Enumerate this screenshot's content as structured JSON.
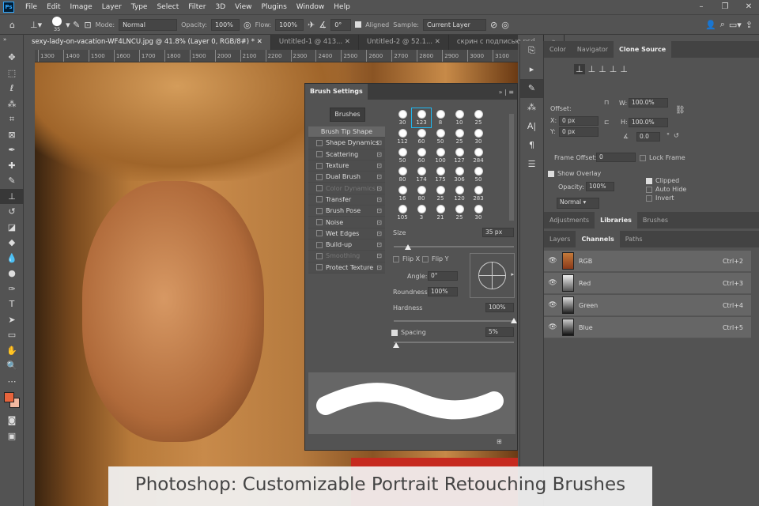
{
  "app": {
    "logo": "Ps"
  },
  "menu": [
    "File",
    "Edit",
    "Image",
    "Layer",
    "Type",
    "Select",
    "Filter",
    "3D",
    "View",
    "Plugins",
    "Window",
    "Help"
  ],
  "options": {
    "brush_size": "35",
    "mode_label": "Mode:",
    "mode": "Normal",
    "opacity_label": "Opacity:",
    "opacity": "100%",
    "flow_label": "Flow:",
    "flow": "100%",
    "angle": "0°",
    "aligned_label": "Aligned",
    "sample_label": "Sample:",
    "sample": "Current Layer"
  },
  "tabs": [
    "sexy-lady-on-vacation-WF4LNCU.jpg @ 41.8% (Layer 0, RGB/8#) *",
    "Untitled-1 @ 413...",
    "Untitled-2 @ 52.1...",
    "скрин с подписью.psd"
  ],
  "ruler": [
    "1300",
    "1400",
    "1500",
    "1600",
    "1700",
    "1800",
    "1900",
    "2000",
    "2100",
    "2200",
    "2300",
    "2400",
    "2500",
    "2600",
    "2700",
    "2800",
    "2900",
    "3000",
    "3100"
  ],
  "brush_settings": {
    "title": "Brush Settings",
    "brushes_button": "Brushes",
    "tip_shape": "Brush Tip Shape",
    "options": [
      {
        "label": "Shape Dynamics",
        "enabled": true
      },
      {
        "label": "Scattering",
        "enabled": true
      },
      {
        "label": "Texture",
        "enabled": true
      },
      {
        "label": "Dual Brush",
        "enabled": true
      },
      {
        "label": "Color Dynamics",
        "enabled": false
      },
      {
        "label": "Transfer",
        "enabled": true
      },
      {
        "label": "Brush Pose",
        "enabled": true
      },
      {
        "label": "Noise",
        "enabled": true
      },
      {
        "label": "Wet Edges",
        "enabled": true
      },
      {
        "label": "Build-up",
        "enabled": true
      },
      {
        "label": "Smoothing",
        "enabled": false
      },
      {
        "label": "Protect Texture",
        "enabled": true
      }
    ],
    "presets": [
      "30",
      "123",
      "8",
      "10",
      "25",
      "112",
      "60",
      "50",
      "25",
      "30",
      "50",
      "60",
      "100",
      "127",
      "284",
      "80",
      "174",
      "175",
      "306",
      "50",
      "16",
      "80",
      "25",
      "120",
      "283",
      "105",
      "3",
      "21",
      "25",
      "30"
    ],
    "selected_preset": 1,
    "size_label": "Size",
    "size": "35 px",
    "size_fraction": 0.12,
    "flip_x": "Flip X",
    "flip_y": "Flip Y",
    "angle_label": "Angle:",
    "angle": "0°",
    "roundness_label": "Roundness:",
    "roundness": "100%",
    "hardness_label": "Hardness",
    "hardness": "100%",
    "hardness_fraction": 1.0,
    "spacing_label": "Spacing",
    "spacing": "5%",
    "spacing_fraction": 0.02
  },
  "clone_source": {
    "tabs": [
      "Color",
      "Navigator",
      "Clone Source"
    ],
    "offset_label": "Offset:",
    "x_label": "X:",
    "x": "0 px",
    "y_label": "Y:",
    "y": "0 px",
    "w_label": "W:",
    "w": "100.0%",
    "h_label": "H:",
    "h": "100.0%",
    "rotation": "0.0",
    "degree": "°",
    "frame_offset_label": "Frame Offset:",
    "frame_offset": "0",
    "lock_frame": "Lock Frame",
    "show_overlay": "Show Overlay",
    "opacity_label": "Opacity:",
    "opacity": "100%",
    "blend": "Normal",
    "clipped": "Clipped",
    "auto_hide": "Auto Hide",
    "invert": "Invert"
  },
  "panel2": {
    "tabs": [
      "Adjustments",
      "Libraries",
      "Brushes"
    ]
  },
  "panel3": {
    "tabs": [
      "Layers",
      "Channels",
      "Paths"
    ],
    "channels": [
      {
        "name": "RGB",
        "shortcut": "Ctrl+2"
      },
      {
        "name": "Red",
        "shortcut": "Ctrl+3"
      },
      {
        "name": "Green",
        "shortcut": "Ctrl+4"
      },
      {
        "name": "Blue",
        "shortcut": "Ctrl+5"
      }
    ]
  },
  "colors": {
    "foreground": "#e8643c",
    "background": "#f2b8a0"
  },
  "caption": "Photoshop: Customizable Portrait Retouching Brushes"
}
